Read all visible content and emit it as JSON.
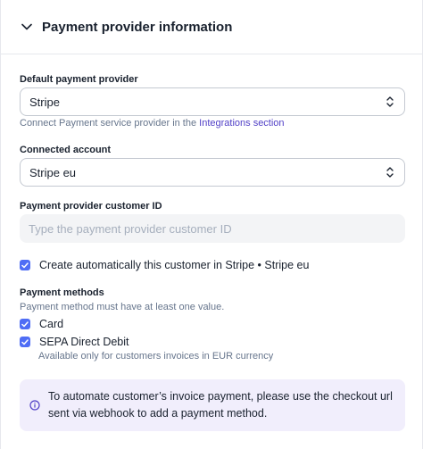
{
  "section": {
    "title": "Payment provider information"
  },
  "default_provider": {
    "label": "Default payment provider",
    "value": "Stripe",
    "helper_prefix": "Connect Payment service provider in the ",
    "helper_link": "Integrations section"
  },
  "connected_account": {
    "label": "Connected account",
    "value": "Stripe eu"
  },
  "customer_id": {
    "label": "Payment provider customer ID",
    "placeholder": "Type the payment provider customer ID"
  },
  "auto_create": {
    "label": "Create automatically this customer in Stripe • Stripe eu",
    "checked": true
  },
  "payment_methods": {
    "label": "Payment methods",
    "helper": "Payment method must have at least one value.",
    "items": [
      {
        "label": "Card",
        "checked": true
      },
      {
        "label": "SEPA Direct Debit",
        "checked": true,
        "sublabel": "Available only for customers invoices in EUR currency"
      }
    ]
  },
  "info_note": {
    "text": "To automate customer’s invoice payment, please use the checkout url sent via webhook to add a payment method."
  },
  "colors": {
    "accent": "#4f6df5",
    "link": "#5140c7",
    "note_bg": "#f1eefc"
  },
  "icons": [
    "chevron-down-icon",
    "select-updown-icon",
    "checkbox-check-icon",
    "info-icon"
  ]
}
